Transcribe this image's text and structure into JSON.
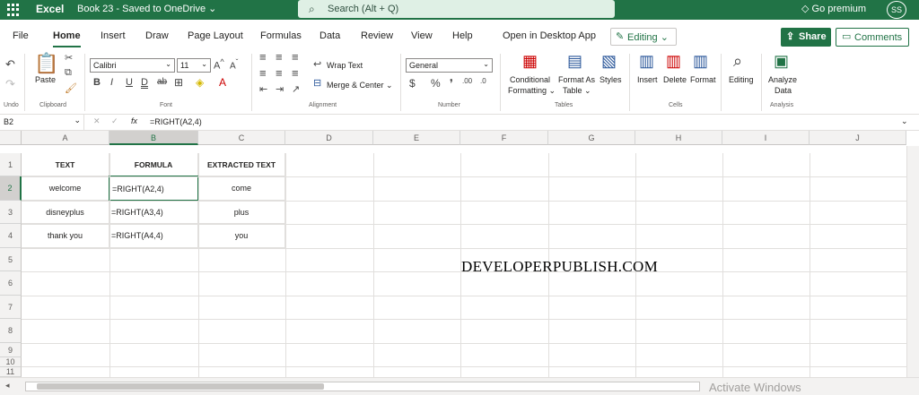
{
  "titlebar": {
    "app_name": "Excel",
    "doc_title": "Book 23  -  Saved to OneDrive ⌄",
    "search_placeholder": "Search (Alt + Q)",
    "premium": "Go premium",
    "avatar_initials": "SS"
  },
  "tabs": [
    "File",
    "Home",
    "Insert",
    "Draw",
    "Page Layout",
    "Formulas",
    "Data",
    "Review",
    "View",
    "Help",
    "Open in Desktop App"
  ],
  "active_tab": "Home",
  "editing_label": "Editing",
  "share_label": "Share",
  "comments_label": "Comments",
  "ribbon": {
    "undo_label": "Undo",
    "clipboard_label": "Clipboard",
    "paste_label": "Paste",
    "font_label": "Font",
    "font_name": "Calibri",
    "font_size": "11",
    "alignment_label": "Alignment",
    "wrap_text": "Wrap Text",
    "merge_center": "Merge & Center",
    "number_label": "Number",
    "number_format": "General",
    "tables_label": "Tables",
    "conditional": "Conditional",
    "formatting": "Formatting",
    "format_as": "Format As",
    "table": "Table",
    "styles": "Styles",
    "cells_label": "Cells",
    "insert": "Insert",
    "delete": "Delete",
    "format": "Format",
    "editing": "Editing",
    "analysis_label": "Analysis",
    "analyze": "Analyze",
    "data": "Data"
  },
  "formula_bar": {
    "name_box": "B2",
    "formula": "=RIGHT(A2,4)",
    "fx": "fx"
  },
  "columns": [
    "A",
    "B",
    "C",
    "D",
    "E",
    "F",
    "G",
    "H",
    "I",
    "J"
  ],
  "rows": [
    "1",
    "2",
    "3",
    "4",
    "5",
    "6",
    "7",
    "8",
    "9",
    "10",
    "11"
  ],
  "cells": {
    "A1": "TEXT",
    "B1": "FORMULA",
    "C1": "EXTRACTED TEXT",
    "A2": "welcome",
    "B2": "=RIGHT(A2,4)",
    "C2": "come",
    "A3": "disneyplus",
    "B3": "=RIGHT(A3,4)",
    "C3": "plus",
    "A4": "thank you",
    "B4": "=RIGHT(A4,4)",
    "C4": "you"
  },
  "watermark": "DEVELOPERPUBLISH.COM",
  "activate_windows": "Activate Windows",
  "colors": {
    "brand": "#217346",
    "search_bg": "#dff0e5"
  }
}
